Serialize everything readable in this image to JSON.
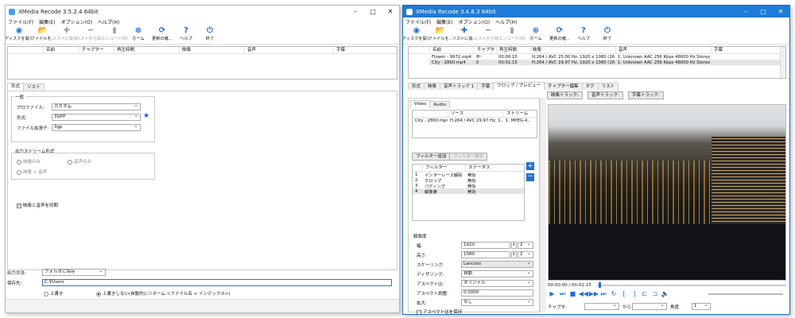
{
  "left": {
    "title": "XMedia Recode 3.5.2.4 64bit",
    "menu": [
      "ファイル(F)",
      "編集(E)",
      "オプション(O)",
      "ヘルプ(H)"
    ],
    "toolbar": [
      {
        "label": "ディスクを開く",
        "icon": "disc-icon",
        "glyph": "◉",
        "enabled": true
      },
      {
        "label": "ファイルを...",
        "icon": "folder-icon",
        "glyph": "📂",
        "enabled": true
      },
      {
        "label": "リストに追加...",
        "icon": "plus-icon",
        "glyph": "✚",
        "enabled": false
      },
      {
        "label": "リストから除...",
        "icon": "minus-icon",
        "glyph": "━",
        "enabled": false
      },
      {
        "label": "エンコード(N)",
        "icon": "encode-icon",
        "glyph": "▮",
        "enabled": false
      },
      {
        "label": "ホーム",
        "icon": "globe-icon",
        "glyph": "⊕",
        "enabled": true
      },
      {
        "label": "更新の確...",
        "icon": "refresh-icon",
        "glyph": "⟳",
        "enabled": true
      },
      {
        "label": "ヘルプ",
        "icon": "help-icon",
        "glyph": "?",
        "enabled": true
      },
      {
        "label": "終了",
        "icon": "power-icon",
        "glyph": "⏻",
        "enabled": true
      }
    ],
    "columns": [
      "名前",
      "チャプター",
      "再生時間",
      "映像",
      "音声",
      "字幕"
    ],
    "tabs": [
      "形式",
      "リスト"
    ],
    "general_label": "一般",
    "profile_label": "プロファイル:",
    "profile_value": "カスタム",
    "format_label": "形式:",
    "format_value": "3GPP",
    "ext_label": "ファイル拡張子:",
    "ext_value": "3gp",
    "stream_label": "出力ストリーム形式",
    "stream_options": [
      "映像のみ",
      "音声のみ",
      "映像 + 音声"
    ],
    "sync_label": "映像と音声を同期",
    "output_method_label": "出力方法:",
    "output_method_value": "フォルダに保存",
    "save_to_label": "保存先:",
    "save_to_value": "C:¥Users",
    "overwrite_label": "上書き",
    "no_overwrite_label": "上書きしない(自動的にリネーム <ファイル名 + インデックス>)"
  },
  "right": {
    "title": "XMedia Recode 3.4.8.3 64bit",
    "menu": [
      "ファイル(F)",
      "編集(E)",
      "オプション(O)",
      "ヘルプ(H)"
    ],
    "toolbar": [
      {
        "label": "ディスクを開く",
        "icon": "disc-icon",
        "glyph": "◉",
        "enabled": true
      },
      {
        "label": "ファイルを...",
        "icon": "folder-icon",
        "glyph": "📂",
        "enabled": true
      },
      {
        "label": "リストに追...",
        "icon": "plus-icon",
        "glyph": "✚",
        "enabled": true
      },
      {
        "label": "リストから除...",
        "icon": "minus-icon",
        "glyph": "━",
        "enabled": false
      },
      {
        "label": "エンコード(N)",
        "icon": "encode-icon",
        "glyph": "▮",
        "enabled": false
      },
      {
        "label": "ホーム",
        "icon": "globe-icon",
        "glyph": "⊕",
        "enabled": true
      },
      {
        "label": "更新の確...",
        "icon": "refresh-icon",
        "glyph": "⟳",
        "enabled": true
      },
      {
        "label": "ヘルプ",
        "icon": "help-icon",
        "glyph": "?",
        "enabled": true
      },
      {
        "label": "終了",
        "icon": "power-icon",
        "glyph": "⏻",
        "enabled": true
      }
    ],
    "columns": [
      "名前",
      "チャプター",
      "再生時間",
      "映像",
      "音声",
      "字幕"
    ],
    "files": [
      [
        "Flower - 9972.mp4",
        "0",
        "00:00:10",
        "H.264 / AVC  25.00 Hz, 1920 x 1080 (16:...",
        "1. Unknown AAC  256 Kbps 48000 Hz Stereo",
        ""
      ],
      [
        "City - 2860.mp4",
        "0",
        "00:01:15",
        "H.264 / AVC  29.97 Hz, 1920 x 1080 (16:...",
        "1. Unknown AAC  256 Kbps 48000 Hz Stereo",
        ""
      ]
    ],
    "tabs": [
      "形式",
      "映像",
      "音声トラック 1",
      "字幕",
      "クロップ / プレビュー",
      "チャプター編集",
      "タグ",
      "リスト"
    ],
    "track_buttons": [
      "映像トラック:",
      "音声トラック:",
      "字幕トラック:"
    ],
    "subtabs": [
      "Video",
      "Audio"
    ],
    "source_cols": [
      "ソース",
      "ストリーム"
    ],
    "source_row": [
      "City - 2860.mp4",
      "H.264 / AVC  29.97 Hz, 1...",
      "1. MPEG-4..."
    ],
    "filter_add": "フィルター追加",
    "filter_remove": "フィルター除去",
    "filter_cols": [
      "フィルター",
      "ステータス"
    ],
    "filters": [
      [
        "1",
        "インターレース解除",
        "無効"
      ],
      [
        "2",
        "クロップ",
        "無効"
      ],
      [
        "3",
        "パディング",
        "無効"
      ],
      [
        "4",
        "解像度",
        "無効"
      ]
    ],
    "resolution_label": "解像度",
    "width_label": "幅:",
    "width_value": "1920",
    "width_ratio": "2",
    "height_label": "高さ:",
    "height_value": "1080",
    "height_ratio": "2",
    "scaling_label": "スケーリング:",
    "scaling_value": "Lanczos",
    "dither_label": "ディザリング:",
    "dither_value": "自動",
    "aspect_label": "アスペクト比:",
    "aspect_value": "オリジナル",
    "aspect_adj_label": "アスペクト調整:",
    "aspect_adj_value": "0.0000",
    "zoom_label": "拡大:",
    "zoom_value": "なし",
    "keep_aspect_label": "アスペクト比を保持",
    "time_display": "00:00:00 / 00:01:15",
    "chapter_label": "チャプタ:",
    "from_label": "から",
    "angle_label": "角度",
    "angle_value": "1"
  }
}
